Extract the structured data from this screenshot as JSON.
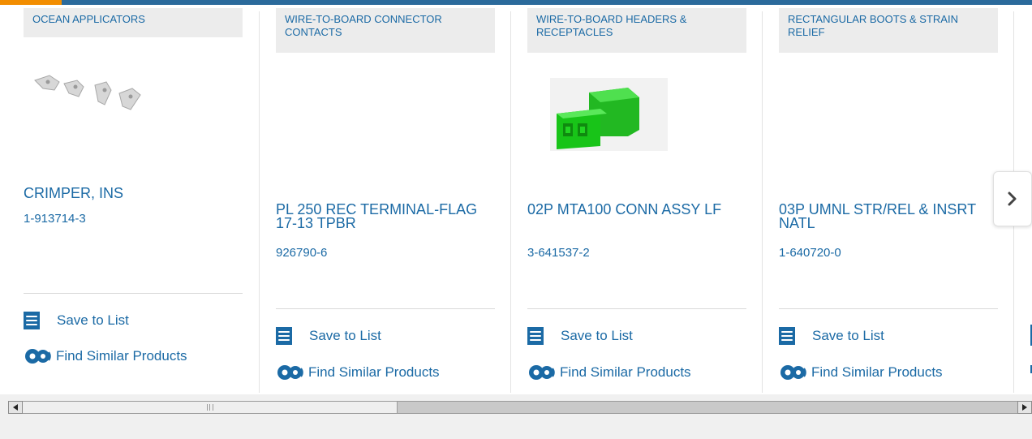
{
  "cards": [
    {
      "category": "OCEAN APPLICATORS",
      "title": "CRIMPER, INS",
      "part_number": "1-913714-3",
      "image": "crimper-terminals",
      "save_label": "Save to List",
      "similar_label": "Find Similar Products"
    },
    {
      "category": "WIRE-TO-BOARD CONNECTOR CONTACTS",
      "title": "PL 250 REC TERMINAL-FLAG 17-13 TPBR",
      "part_number": "926790-6",
      "image": "",
      "save_label": "Save to List",
      "similar_label": "Find Similar Products"
    },
    {
      "category": "WIRE-TO-BOARD HEADERS & RECEPTACLES",
      "title": "02P MTA100 CONN ASSY LF",
      "part_number": "3-641537-2",
      "image": "green-connector",
      "save_label": "Save to List",
      "similar_label": "Find Similar Products"
    },
    {
      "category": "RECTANGULAR BOOTS & STRAIN RELIEF",
      "title": "03P UMNL STR/REL & INSRT NATL",
      "part_number": "1-640720-0",
      "image": "",
      "save_label": "Save to List",
      "similar_label": "Find Similar Products"
    }
  ],
  "carousel": {
    "next_icon": "chevron-right-icon"
  },
  "colors": {
    "link": "#1b6aa5",
    "accent_bar": "#2b6a9b",
    "accent_orange": "#f28d00"
  }
}
